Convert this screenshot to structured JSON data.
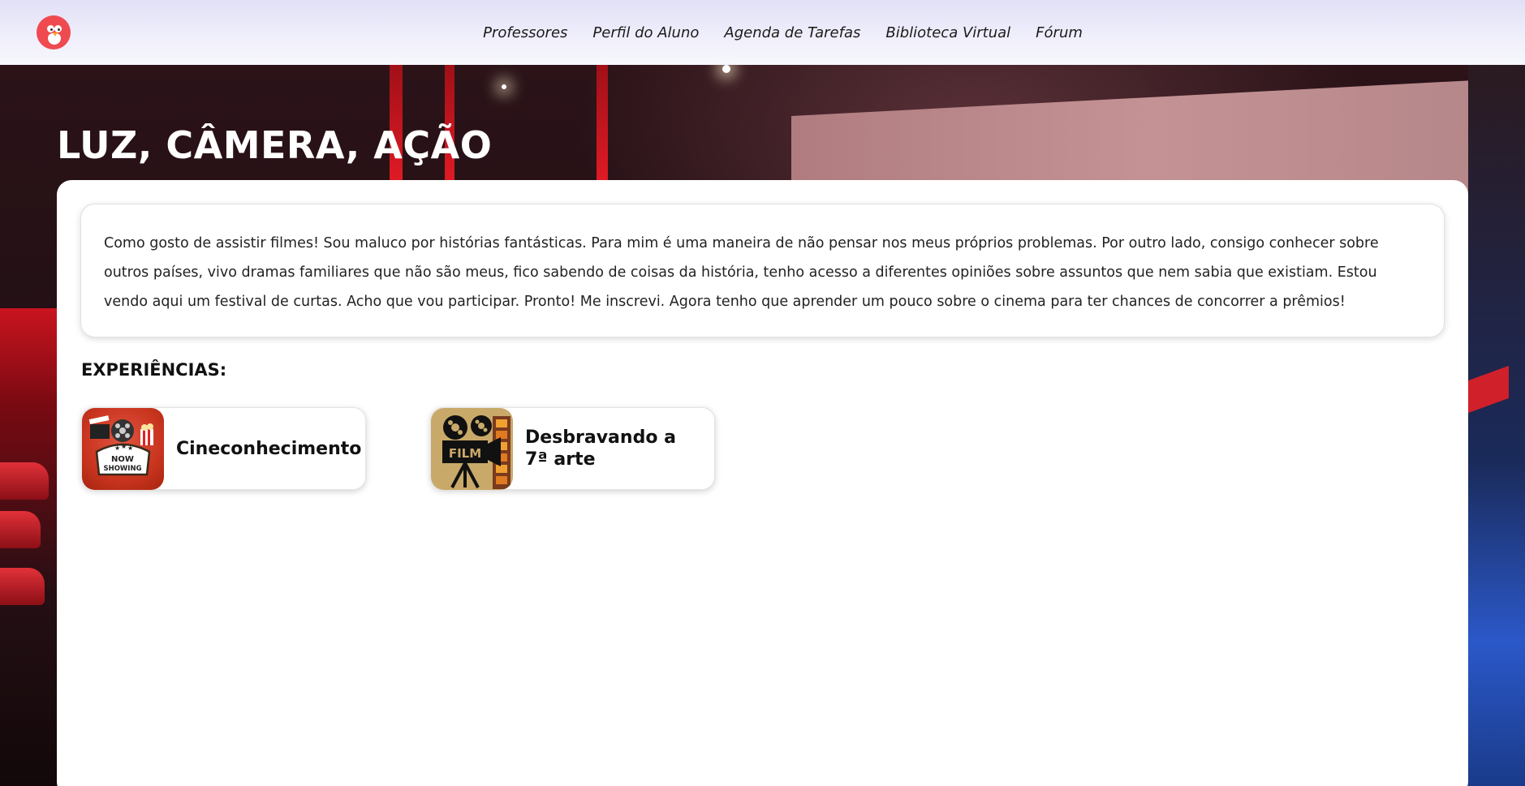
{
  "nav": {
    "items": [
      {
        "label": "Professores"
      },
      {
        "label": "Perfil do Aluno"
      },
      {
        "label": "Agenda de Tarefas"
      },
      {
        "label": "Biblioteca Virtual"
      },
      {
        "label": "Fórum"
      }
    ]
  },
  "page": {
    "title": "LUZ, CÂMERA, AÇÃO",
    "intro": "Como gosto de assistir filmes! Sou maluco por histórias fantásticas. Para mim é uma maneira de não pensar nos meus próprios problemas. Por outro lado, consigo conhecer sobre outros países, vivo dramas familiares que não são meus, fico sabendo de coisas da história, tenho acesso a diferentes opiniões sobre assuntos que nem sabia que existiam. Estou vendo aqui um festival de curtas. Acho que vou participar. Pronto! Me inscrevi. Agora tenho que aprender um pouco sobre o cinema para ter chances de concorrer a prêmios!"
  },
  "experiences": {
    "heading": "EXPERIÊNCIAS:",
    "items": [
      {
        "label": "Cineconhecimento",
        "thumb_text_1": "NOW",
        "thumb_text_2": "SHOWING",
        "icon": "now-showing-icon"
      },
      {
        "label": "Desbravando a 7ª arte",
        "thumb_text": "FILM",
        "icon": "film-projector-icon"
      }
    ]
  },
  "colors": {
    "brand": "#ef4a4f",
    "header_bg": "#e2e0f7"
  }
}
